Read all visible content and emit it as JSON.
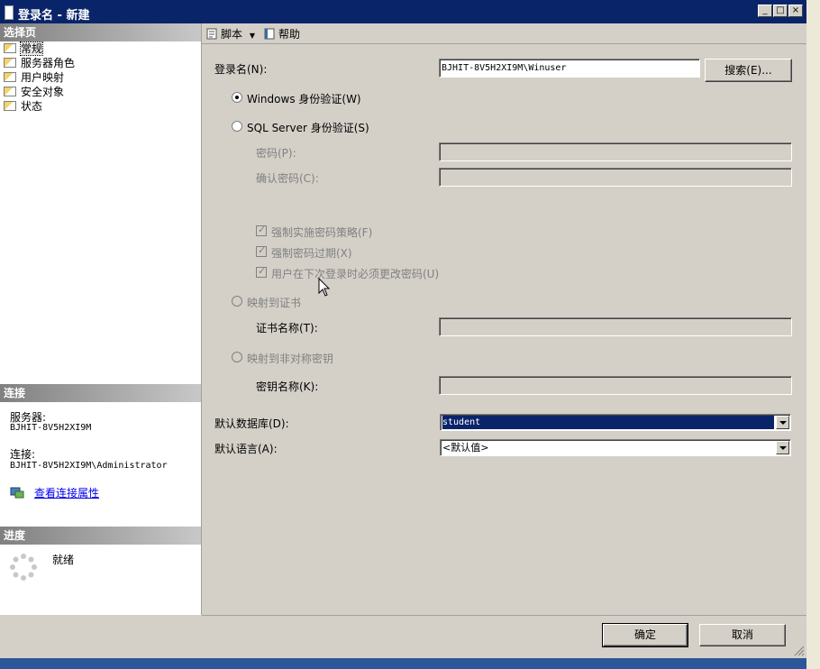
{
  "window": {
    "title": "登录名 - 新建",
    "controls": {
      "minimize": "_",
      "maximize": "□",
      "close": "×"
    }
  },
  "left": {
    "select_page_header": "选择页",
    "pages": [
      {
        "label": "常规",
        "selected": true
      },
      {
        "label": "服务器角色"
      },
      {
        "label": "用户映射"
      },
      {
        "label": "安全对象"
      },
      {
        "label": "状态"
      }
    ],
    "connection": {
      "header": "连接",
      "server_label": "服务器:",
      "server_value": "BJHIT-8V5H2XI9M",
      "connection_label": "连接:",
      "connection_value": "BJHIT-8V5H2XI9M\\Administrator",
      "view_props_link": "查看连接属性"
    },
    "progress": {
      "header": "进度",
      "status": "就绪"
    }
  },
  "toolbar": {
    "script_label": "脚本",
    "help_label": "帮助"
  },
  "form": {
    "login_name_label": "登录名(N):",
    "login_name_value": "BJHIT-8V5H2XI9M\\Winuser",
    "search_button": "搜索(E)...",
    "windows_auth_label": "Windows 身份验证(W)",
    "sql_auth_label": "SQL Server 身份验证(S)",
    "password_label": "密码(P):",
    "confirm_password_label": "确认密码(C):",
    "enforce_policy_label": "强制实施密码策略(F)",
    "enforce_expiration_label": "强制密码过期(X)",
    "must_change_label": "用户在下次登录时必须更改密码(U)",
    "map_cert_label": "映射到证书",
    "cert_name_label": "证书名称(T):",
    "map_asym_key_label": "映射到非对称密钥",
    "key_name_label": "密钥名称(K):",
    "default_db_label": "默认数据库(D):",
    "default_db_value": "student",
    "default_lang_label": "默认语言(A):",
    "default_lang_value": "<默认值>"
  },
  "footer": {
    "ok_button": "确定",
    "cancel_button": "取消"
  }
}
